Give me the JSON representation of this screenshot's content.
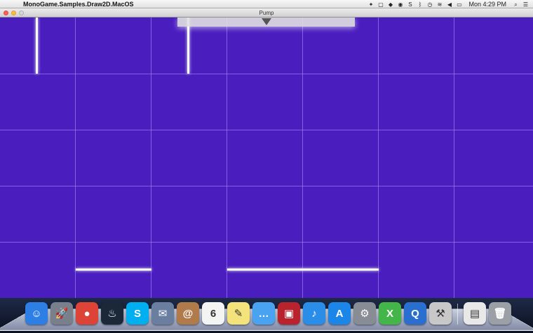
{
  "menubar": {
    "apple_glyph": "",
    "app_name": "MonoGame.Samples.Draw2D.MacOS",
    "status_icons": [
      "dropbox-icon",
      "document-icon",
      "evernote-icon",
      "sync-icon",
      "skype-icon",
      "bluetooth-icon",
      "time-machine-icon",
      "wifi-icon",
      "volume-icon",
      "battery-icon"
    ],
    "clock": "Mon 4:29 PM",
    "right_icons": [
      "spotlight-icon",
      "notification-center-icon"
    ]
  },
  "window": {
    "title": "Pump"
  },
  "game": {
    "background": "#4a1dbf",
    "grid_color": "#b496ff",
    "bar_color": "#ffffff"
  },
  "dock": {
    "apps": [
      {
        "name": "finder-icon",
        "glyph": "☺",
        "color": "#2d7fe6"
      },
      {
        "name": "launchpad-icon",
        "glyph": "🚀",
        "color": "#7a7f8c"
      },
      {
        "name": "chrome-icon",
        "glyph": "●",
        "color": "#dd4437"
      },
      {
        "name": "steam-icon",
        "glyph": "♨",
        "color": "#1b2838"
      },
      {
        "name": "skype-icon",
        "glyph": "S",
        "color": "#00aff0"
      },
      {
        "name": "mail-icon",
        "glyph": "✉",
        "color": "#6a7fa0"
      },
      {
        "name": "contacts-icon",
        "glyph": "@",
        "color": "#b07a4a"
      },
      {
        "name": "calendar-icon",
        "glyph": "6",
        "color": "#f4f4f4"
      },
      {
        "name": "notes-icon",
        "glyph": "✎",
        "color": "#f4e27a"
      },
      {
        "name": "messages-icon",
        "glyph": "…",
        "color": "#4aa3f0"
      },
      {
        "name": "photo-booth-icon",
        "glyph": "▣",
        "color": "#b8232d"
      },
      {
        "name": "itunes-icon",
        "glyph": "♪",
        "color": "#2a8de8"
      },
      {
        "name": "app-store-icon",
        "glyph": "A",
        "color": "#1c86e8"
      },
      {
        "name": "system-preferences-icon",
        "glyph": "⚙",
        "color": "#888c94"
      },
      {
        "name": "xamarin-icon",
        "glyph": "X",
        "color": "#44b649"
      },
      {
        "name": "quicktime-icon",
        "glyph": "Q",
        "color": "#2a6fcf"
      },
      {
        "name": "xcode-icon",
        "glyph": "⚒",
        "color": "#c8c8c8"
      }
    ],
    "trailing": [
      {
        "name": "documents-stack-icon",
        "glyph": "▤",
        "color": "#e8e8e8"
      },
      {
        "name": "trash-icon",
        "glyph": "🗑",
        "color": "#9aa0a6"
      }
    ]
  }
}
